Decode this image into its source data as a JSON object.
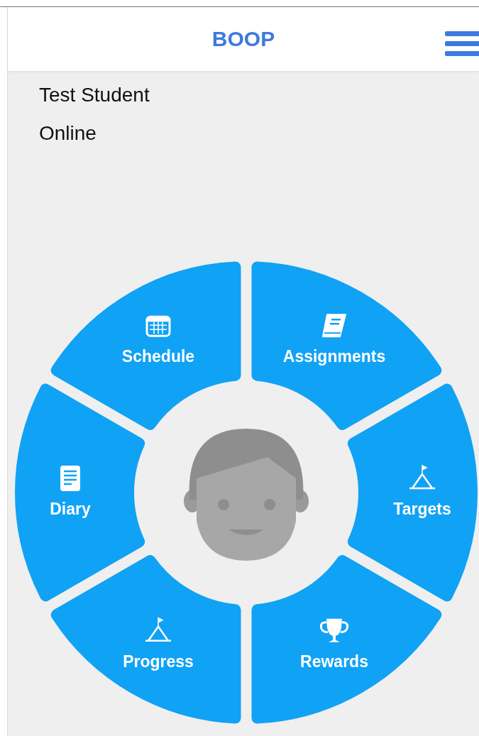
{
  "header": {
    "title": "BOOP"
  },
  "profile": {
    "name": "Test Student",
    "status": "Online"
  },
  "menu": [
    {
      "label": "Schedule",
      "kind": "calendar"
    },
    {
      "label": "Assignments",
      "kind": "book"
    },
    {
      "label": "Diary",
      "kind": "document"
    },
    {
      "label": "Targets",
      "kind": "flag"
    },
    {
      "label": "Progress",
      "kind": "flag"
    },
    {
      "label": "Rewards",
      "kind": "trophy"
    }
  ]
}
